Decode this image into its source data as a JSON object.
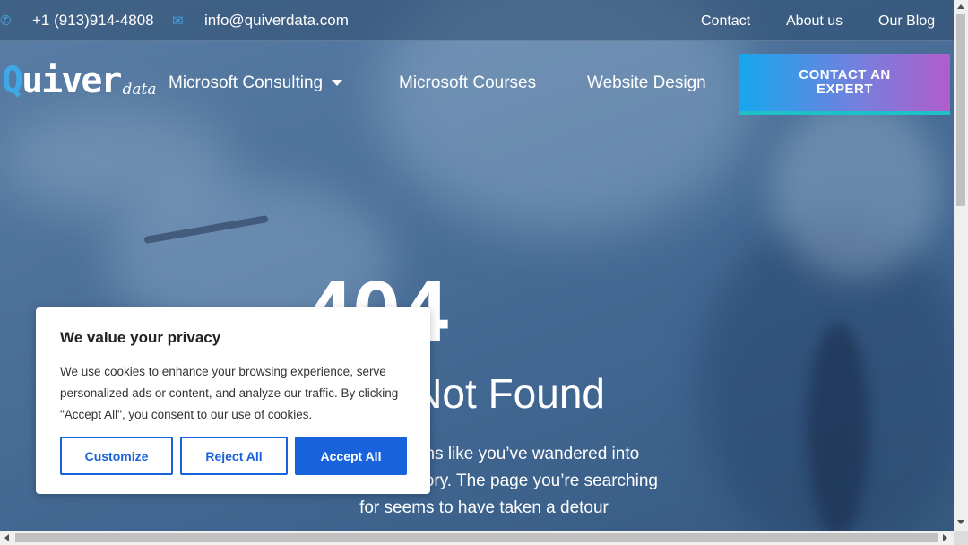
{
  "topbar": {
    "phone": "+1 (913)914-4808",
    "email": "info@quiverdata.com",
    "links": [
      "Contact",
      "About us",
      "Our Blog"
    ]
  },
  "logo": {
    "main_q": "Q",
    "main_rest": "uiver",
    "sub": "data"
  },
  "nav": {
    "items": [
      "Microsoft Consulting",
      "Microsoft Courses",
      "Website Design"
    ],
    "cta": "CONTACT AN EXPERT"
  },
  "hero": {
    "code": "404",
    "title": "Page Not Found",
    "text": "Oops! It seems like you’ve wandered into uncharted territory. The page you’re searching for seems to have taken a detour"
  },
  "cookie": {
    "title": "We value your privacy",
    "text": "We use cookies to enhance your browsing experience, serve personalized ads or content, and analyze our traffic. By clicking \"Accept All\", you consent to our use of cookies.",
    "customize": "Customize",
    "reject": "Reject All",
    "accept": "Accept All"
  },
  "colors": {
    "accent": "#3fa8e6",
    "button_blue": "#1863dc"
  }
}
